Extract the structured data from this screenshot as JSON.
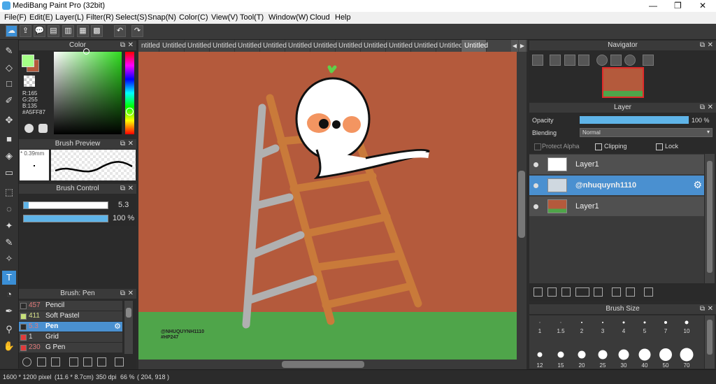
{
  "window": {
    "title": "MediBang Paint Pro (32bit)",
    "minimize": "—",
    "restore": "❐",
    "close": "✕"
  },
  "menu": [
    "File(F)",
    "Edit(E)",
    "Layer(L)",
    "Filter(R)",
    "Select(S)",
    "Snap(N)",
    "Color(C)",
    "View(V)",
    "Tool(T)",
    "Window(W)",
    "Cloud",
    "Help"
  ],
  "color_panel": {
    "title": "Color",
    "r": "R:165",
    "g": "G:255",
    "b": "B:135",
    "hex": "#A5FF87",
    "fg": "#A5FF87",
    "bg": "#B45A3C"
  },
  "brush_preview": {
    "title": "Brush Preview",
    "size": "* 0.39mm"
  },
  "brush_control": {
    "title": "Brush Control",
    "size_value": "5.3",
    "opacity_value": "100 %",
    "size_fraction": 0.06,
    "opacity_fraction": 1.0
  },
  "brush_list": {
    "title": "Brush: Pen",
    "items": [
      {
        "size": "457",
        "name": "Pencil",
        "swatch": "#2b2b2b",
        "size_color": "#e07a7a"
      },
      {
        "size": "411",
        "name": "Soft Pastel",
        "swatch": "#c7e07a",
        "size_color": "#d6e08a"
      },
      {
        "size": "5.3",
        "name": "Pen",
        "swatch": "#2b2b2b",
        "size_color": "#e07a7a",
        "selected": true
      },
      {
        "size": "1",
        "name": "Grid",
        "swatch": "#e03a3a",
        "size_color": "#dddddd"
      },
      {
        "size": "230",
        "name": "G Pen",
        "swatch": "#e03a3a",
        "size_color": "#e07a7a"
      }
    ]
  },
  "tabs": [
    "ntitled",
    "Untitled",
    "Untitled",
    "Untitled",
    "Untitled",
    "Untitled",
    "Untitled",
    "Untitled",
    "Untitled",
    "Untitled",
    "Untitled",
    "Untitled",
    "Untitled",
    "Untitled"
  ],
  "active_tab_index": 13,
  "canvas": {
    "watermark_line1": "@NHUQUYNH1110",
    "watermark_line2": "#HP247",
    "background": "#B45A3C",
    "grass": "#4fa54a"
  },
  "navigator": {
    "title": "Navigator"
  },
  "layer_panel": {
    "title": "Layer",
    "opacity_label": "Opacity",
    "opacity_value": "100 %",
    "opacity_fraction": 1.0,
    "blending_label": "Blending",
    "blending_value": "Normal",
    "protect_alpha": "Protect Alpha",
    "clipping": "Clipping",
    "lock": "Lock",
    "layers": [
      {
        "name": "Layer1",
        "selected": false
      },
      {
        "name": "@nhuquynh1110",
        "selected": true
      },
      {
        "name": "Layer1",
        "selected": false
      }
    ]
  },
  "brush_size": {
    "title": "Brush Size",
    "row1": [
      "1",
      "1.5",
      "2",
      "3",
      "4",
      "5",
      "7",
      "10"
    ],
    "row2": [
      "12",
      "15",
      "20",
      "25",
      "30",
      "40",
      "50",
      "70"
    ]
  },
  "status": {
    "dimensions": "1600 * 1200 pixel",
    "physical": "(11.6 * 8.7cm)",
    "dpi": "350 dpi",
    "zoom": "66 %",
    "cursor": "( 204, 918 )"
  }
}
